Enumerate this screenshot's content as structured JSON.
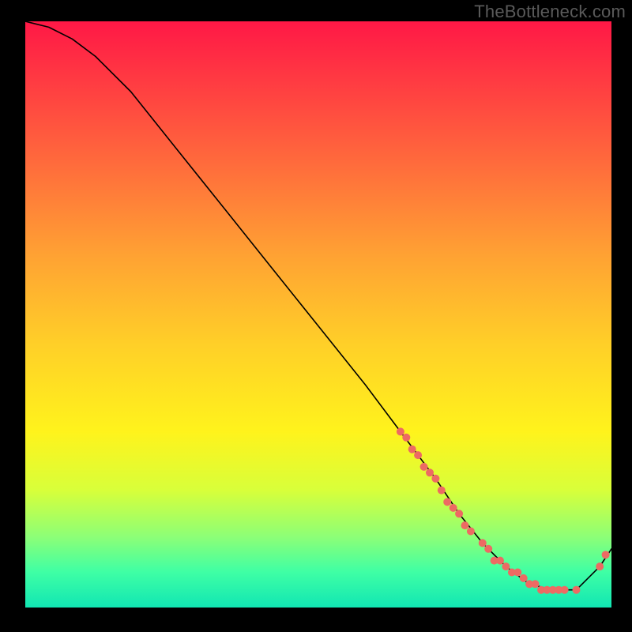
{
  "watermark": "TheBottleneck.com",
  "chart_data": {
    "type": "line",
    "title": "",
    "xlabel": "",
    "ylabel": "",
    "xlim": [
      0,
      100
    ],
    "ylim": [
      0,
      100
    ],
    "series": [
      {
        "name": "bottleneck-curve",
        "x": [
          0,
          4,
          8,
          12,
          18,
          26,
          34,
          42,
          50,
          58,
          64,
          70,
          74,
          78,
          82,
          86,
          90,
          94,
          98,
          100
        ],
        "y": [
          100,
          99,
          97,
          94,
          88,
          78,
          68,
          58,
          48,
          38,
          30,
          22,
          16,
          11,
          7,
          4,
          3,
          3,
          7,
          10
        ]
      }
    ],
    "points": {
      "name": "sample-dots",
      "x": [
        64,
        65,
        66,
        67,
        68,
        69,
        70,
        71,
        72,
        73,
        74,
        75,
        76,
        78,
        79,
        80,
        81,
        82,
        83,
        84,
        85,
        86,
        87,
        88,
        89,
        90,
        91,
        92,
        94,
        98,
        99
      ],
      "y": [
        30,
        29,
        27,
        26,
        24,
        23,
        22,
        20,
        18,
        17,
        16,
        14,
        13,
        11,
        10,
        8,
        8,
        7,
        6,
        6,
        5,
        4,
        4,
        3,
        3,
        3,
        3,
        3,
        3,
        7,
        9
      ]
    }
  }
}
